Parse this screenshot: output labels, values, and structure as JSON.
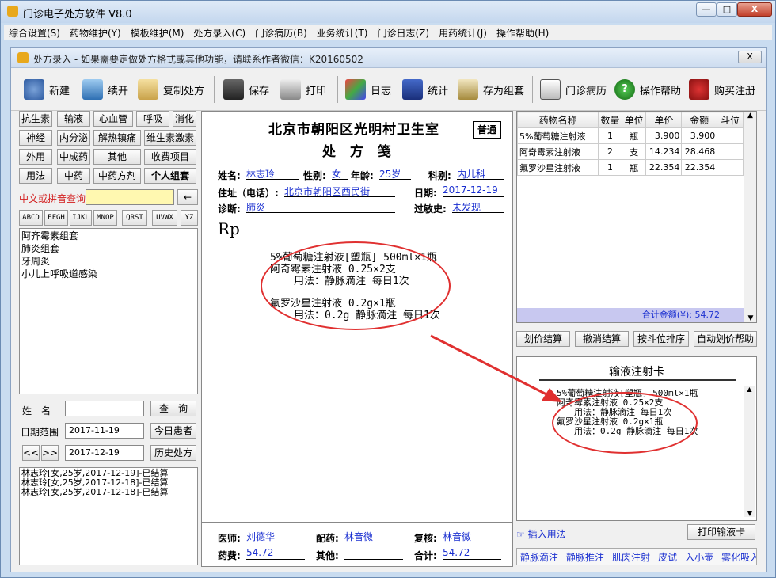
{
  "app": {
    "title": "门诊电子处方软件 V8.0",
    "window_buttons": [
      "—",
      "□",
      "X"
    ]
  },
  "menu": [
    "综合设置(S)",
    "药物维护(Y)",
    "模板维护(M)",
    "处方录入(C)",
    "门诊病历(B)",
    "业务统计(T)",
    "门诊日志(Z)",
    "用药统计(J)",
    "操作帮助(H)"
  ],
  "child": {
    "title": "处方录入 - 如果需要定做处方格式或其他功能，请联系作者微信：K20160502",
    "close": "X"
  },
  "toolbar": {
    "new": "新建",
    "continue": "续开",
    "copy": "复制处方",
    "save": "保存",
    "print": "打印",
    "log": "日志",
    "stats": "统计",
    "save_group": "存为组套",
    "records": "门诊病历",
    "help": "操作帮助",
    "buy": "购买注册"
  },
  "categories": [
    "抗生素",
    "输液",
    "心血管",
    "呼吸",
    "消化",
    "神经",
    "内分泌",
    "解热镇痛",
    "维生素激素",
    "外用",
    "中成药",
    "其他",
    "收费项目",
    "用法",
    "中药",
    "中药方剂",
    "个人组套"
  ],
  "search": {
    "label": "中文或拼音查询",
    "back": "←",
    "letters": [
      "ABCD",
      "EFGH",
      "IJKL",
      "MNOP",
      "QRST",
      "UVWX",
      "YZ"
    ]
  },
  "groups": [
    "阿齐霉素组套",
    "肺炎组套",
    "牙周炎",
    "小儿上呼吸道感染"
  ],
  "patient_query": {
    "name_label": "姓　名",
    "query": "查　询",
    "date_range_label": "日期范围",
    "date_from": "2017-11-19",
    "today": "今日患者",
    "prev": "<<",
    "next": ">>",
    "date_to": "2017-12-19",
    "history": "历史处方"
  },
  "history": [
    "林志玲[女,25岁,2017-12-19]-已结算",
    "林志玲[女,25岁,2017-12-18]-已结算",
    "林志玲[女,25岁,2017-12-18]-已结算"
  ],
  "prescription": {
    "clinic": "北京市朝阳区光明村卫生室",
    "kind": "普通",
    "title": "处 方 笺",
    "name_label": "姓名:",
    "name": "林志玲",
    "sex_label": "性别:",
    "sex": "女",
    "age_label": "年龄:",
    "age": "25岁",
    "dept_label": "科别:",
    "dept": "内儿科",
    "addr_label": "住址（电话）:",
    "addr": "北京市朝阳区西民街",
    "date_label": "日期:",
    "date": "2017-12-19",
    "diag_label": "诊断:",
    "diag": "肺炎",
    "allergy_label": "过敏史:",
    "allergy": "未发现",
    "rp": "Rp",
    "lines": [
      "5%葡萄糖注射液[塑瓶] 500ml×1瓶",
      "阿奇霉素注射液 0.25×2支",
      "用法：静脉滴注 每日1次",
      "氟罗沙星注射液 0.2g×1瓶",
      "用法：0.2g 静脉滴注 每日1次"
    ],
    "doctor_label": "医师:",
    "doctor": "刘德华",
    "dispense_label": "配药:",
    "dispense": "林音微",
    "check_label": "复核:",
    "check": "林音微",
    "fee_label": "药费:",
    "fee": "54.72",
    "other_label": "其他:",
    "other": "",
    "total_label": "合计:",
    "total": "54.72"
  },
  "drug_table": {
    "headers": [
      "药物名称",
      "数量",
      "单位",
      "单价",
      "金额",
      "斗位"
    ],
    "rows": [
      [
        "5%葡萄糖注射液",
        "1",
        "瓶",
        "3.900",
        "3.900",
        ""
      ],
      [
        "阿奇霉素注射液",
        "2",
        "支",
        "14.234",
        "28.468",
        ""
      ],
      [
        "氟罗沙星注射液",
        "1",
        "瓶",
        "22.354",
        "22.354",
        ""
      ]
    ],
    "total": "合计金额(¥): 54.72"
  },
  "actions": [
    "划价结算",
    "撤消结算",
    "按斗位排序",
    "自动划价帮助"
  ],
  "infusion": {
    "title": "输液注射卡",
    "lines": [
      "5%葡萄糖注射液[塑瓶] 500ml×1瓶",
      "阿奇霉素注射液 0.25×2支",
      "用法：静脉滴注 每日1次",
      "氟罗沙星注射液 0.2g×1瓶",
      "用法：0.2g 静脉滴注 每日1次"
    ],
    "insert": "插入用法",
    "print": "打印输液卡"
  },
  "routes": [
    "静脉滴注",
    "静脉推注",
    "肌肉注射",
    "皮试",
    "入小壶",
    "雾化吸入"
  ]
}
